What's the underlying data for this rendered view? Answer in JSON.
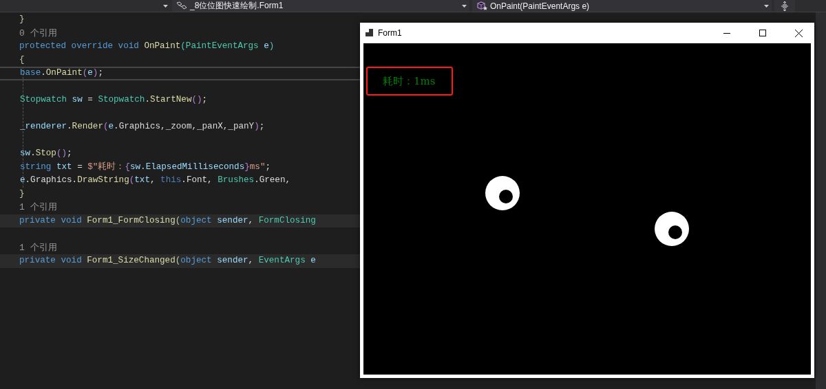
{
  "nav_bar": {
    "dropdowns": [
      {
        "label": "_8位位图快速绘制.Form1",
        "kind": "class"
      },
      {
        "label": "OnPaint(PaintEventArgs e)",
        "kind": "method"
      }
    ]
  },
  "editor": {
    "lines": [
      {
        "kind": "code",
        "current": false,
        "shaded": false,
        "tokens": [
          {
            "text": "}",
            "kind": "brace"
          }
        ]
      },
      {
        "kind": "ref",
        "current": false,
        "shaded": false,
        "tokens": [
          {
            "text": "0 个引用",
            "kind": "ref"
          }
        ]
      },
      {
        "kind": "code",
        "current": false,
        "shaded": false,
        "tokens": [
          {
            "text": "protected override void ",
            "kind": "kw"
          },
          {
            "text": "OnPaint",
            "kind": "method"
          },
          {
            "text": "(",
            "kind": "paren"
          },
          {
            "text": "PaintEventArgs ",
            "kind": "type"
          },
          {
            "text": "e",
            "kind": "var"
          },
          {
            "text": ")",
            "kind": "paren"
          }
        ]
      },
      {
        "kind": "code",
        "current": false,
        "shaded": false,
        "tokens": [
          {
            "text": "{",
            "kind": "brace"
          }
        ],
        "children": [
          {
            "kind": "code",
            "current": true,
            "shaded": false,
            "tokens": [
              {
                "text": "base",
                "kind": "kw"
              },
              {
                "text": ".",
                "kind": "plain"
              },
              {
                "text": "OnPaint",
                "kind": "method"
              },
              {
                "text": "(",
                "kind": "paren2"
              },
              {
                "text": "e",
                "kind": "var"
              },
              {
                "text": ")",
                "kind": "paren2"
              },
              {
                "text": ";",
                "kind": "plain"
              }
            ]
          },
          {
            "kind": "blank",
            "current": false,
            "shaded": false
          },
          {
            "kind": "code",
            "current": false,
            "shaded": false,
            "tokens": [
              {
                "text": "Stopwatch ",
                "kind": "type"
              },
              {
                "text": "sw",
                "kind": "var"
              },
              {
                "text": " = ",
                "kind": "plain"
              },
              {
                "text": "Stopwatch",
                "kind": "type"
              },
              {
                "text": ".",
                "kind": "plain"
              },
              {
                "text": "StartNew",
                "kind": "method"
              },
              {
                "text": "()",
                "kind": "paren2"
              },
              {
                "text": ";",
                "kind": "plain"
              }
            ]
          },
          {
            "kind": "blank",
            "current": false,
            "shaded": false
          },
          {
            "kind": "code",
            "current": false,
            "shaded": false,
            "tokens": [
              {
                "text": "_renderer",
                "kind": "var"
              },
              {
                "text": ".",
                "kind": "plain"
              },
              {
                "text": "Render",
                "kind": "method"
              },
              {
                "text": "(",
                "kind": "paren2"
              },
              {
                "text": "e",
                "kind": "var"
              },
              {
                "text": ".Graphics,_zoom,_panX,_panY",
                "kind": "plain"
              },
              {
                "text": ")",
                "kind": "paren2"
              },
              {
                "text": ";",
                "kind": "plain"
              }
            ]
          },
          {
            "kind": "blank",
            "current": false,
            "shaded": false
          },
          {
            "kind": "code",
            "current": false,
            "shaded": false,
            "tokens": [
              {
                "text": "sw",
                "kind": "var"
              },
              {
                "text": ".",
                "kind": "plain"
              },
              {
                "text": "Stop",
                "kind": "method"
              },
              {
                "text": "()",
                "kind": "paren2"
              },
              {
                "text": ";",
                "kind": "plain"
              }
            ]
          },
          {
            "kind": "code",
            "current": false,
            "shaded": false,
            "tokens": [
              {
                "text": "string ",
                "kind": "kw"
              },
              {
                "text": "txt",
                "kind": "var"
              },
              {
                "text": " = ",
                "kind": "plain"
              },
              {
                "text": "$\"耗时：",
                "kind": "string"
              },
              {
                "text": "{",
                "kind": "paren2"
              },
              {
                "text": "sw.ElapsedMilliseconds",
                "kind": "var"
              },
              {
                "text": "}",
                "kind": "paren2"
              },
              {
                "text": "ms\"",
                "kind": "string"
              },
              {
                "text": ";",
                "kind": "plain"
              }
            ]
          },
          {
            "kind": "code",
            "current": false,
            "shaded": false,
            "tokens": [
              {
                "text": "e",
                "kind": "var"
              },
              {
                "text": ".Graphics.",
                "kind": "plain"
              },
              {
                "text": "DrawString",
                "kind": "method"
              },
              {
                "text": "(",
                "kind": "paren2"
              },
              {
                "text": "txt",
                "kind": "var"
              },
              {
                "text": ", ",
                "kind": "plain"
              },
              {
                "text": "this",
                "kind": "kw2"
              },
              {
                "text": ".Font, ",
                "kind": "plain"
              },
              {
                "text": "Brushes",
                "kind": "type"
              },
              {
                "text": ".Green,",
                "kind": "plain"
              }
            ]
          }
        ]
      },
      {
        "kind": "code",
        "current": false,
        "shaded": false,
        "tokens": [
          {
            "text": "}",
            "kind": "brace"
          }
        ]
      },
      {
        "kind": "ref",
        "current": false,
        "shaded": false,
        "tokens": [
          {
            "text": "1 个引用",
            "kind": "ref"
          }
        ]
      },
      {
        "kind": "code",
        "current": false,
        "shaded": true,
        "tokens": [
          {
            "text": "private void ",
            "kind": "kw"
          },
          {
            "text": "Form1_FormClosing",
            "kind": "method"
          },
          {
            "text": "(",
            "kind": "paren3"
          },
          {
            "text": "object ",
            "kind": "kw"
          },
          {
            "text": "sender",
            "kind": "var"
          },
          {
            "text": ", ",
            "kind": "plain"
          },
          {
            "text": "FormClosing",
            "kind": "type"
          }
        ]
      },
      {
        "kind": "blank",
        "current": false,
        "shaded": false
      },
      {
        "kind": "ref",
        "current": false,
        "shaded": false,
        "tokens": [
          {
            "text": "1 个引用",
            "kind": "ref"
          }
        ]
      },
      {
        "kind": "code",
        "current": false,
        "shaded": true,
        "tokens": [
          {
            "text": "private void ",
            "kind": "kw"
          },
          {
            "text": "Form1_SizeChanged",
            "kind": "method"
          },
          {
            "text": "(",
            "kind": "paren3"
          },
          {
            "text": "object ",
            "kind": "kw"
          },
          {
            "text": "sender",
            "kind": "var"
          },
          {
            "text": ", ",
            "kind": "plain"
          },
          {
            "text": "EventArgs ",
            "kind": "type"
          },
          {
            "text": "e",
            "kind": "var"
          }
        ]
      }
    ]
  },
  "form_window": {
    "title": "Form1",
    "timing_label": "耗时：1ms"
  }
}
